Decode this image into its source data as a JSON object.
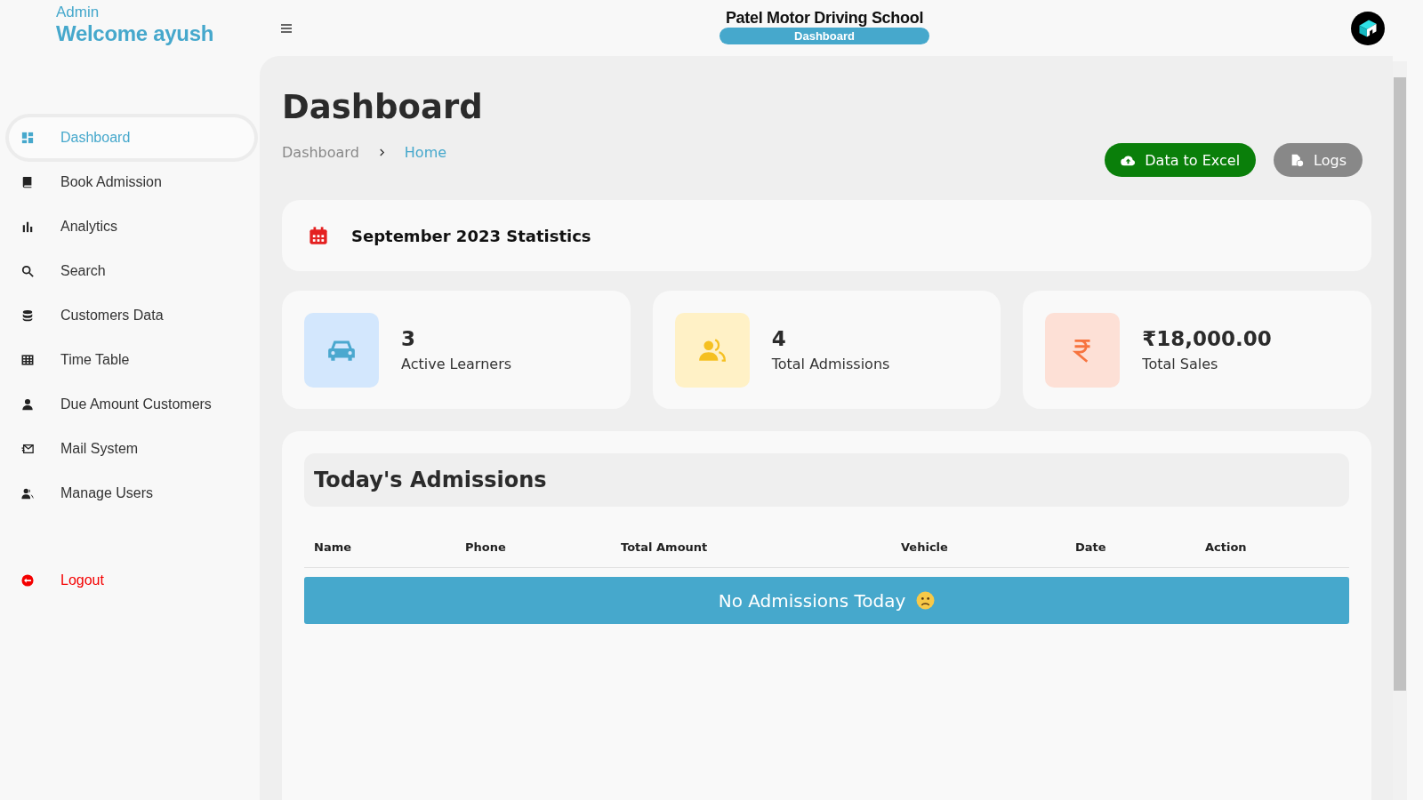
{
  "sidebar": {
    "role": "Admin",
    "welcome": "Welcome ayush",
    "items": [
      {
        "label": "Dashboard",
        "kind": "grid",
        "selected": true
      },
      {
        "label": "Book Admission",
        "kind": "book",
        "selected": false
      },
      {
        "label": "Analytics",
        "kind": "bars",
        "selected": false
      },
      {
        "label": "Search",
        "kind": "search",
        "selected": false
      },
      {
        "label": "Customers Data",
        "kind": "database",
        "selected": false
      },
      {
        "label": "Time Table",
        "kind": "table",
        "selected": false
      },
      {
        "label": "Due Amount Customers",
        "kind": "person",
        "selected": false
      },
      {
        "label": "Mail System",
        "kind": "mail",
        "selected": false
      },
      {
        "label": "Manage Users",
        "kind": "people",
        "selected": false
      }
    ],
    "logout": "Logout"
  },
  "header": {
    "title": "Patel Motor Driving School",
    "badge": "Dashboard"
  },
  "page": {
    "title": "Dashboard",
    "breadcrumb": [
      "Dashboard",
      "Home"
    ],
    "buttons": [
      {
        "label": "Data to Excel",
        "kind": "excel"
      },
      {
        "label": "Logs",
        "kind": "logs"
      }
    ],
    "stats_title": "September 2023 Statistics",
    "stats": [
      {
        "value": "3",
        "label": "Active Learners",
        "kind": "car"
      },
      {
        "value": "4",
        "label": "Total Admissions",
        "kind": "people"
      },
      {
        "value": "₹18,000.00",
        "label": "Total Sales",
        "kind": "rupee"
      }
    ],
    "admissions": {
      "title": "Today's Admissions",
      "columns": [
        "Name",
        "Phone",
        "Total Amount",
        "Vehicle",
        "Date",
        "Action"
      ],
      "empty": "No Admissions Today"
    }
  }
}
